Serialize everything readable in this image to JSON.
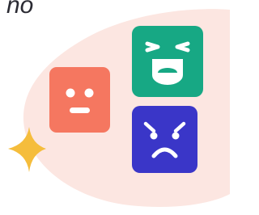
{
  "corner_text": "no",
  "colors": {
    "backdrop": "#fce6e1",
    "neutral_face": "#f57760",
    "shocked_face": "#17a884",
    "sad_face": "#3a36c8",
    "sparkle": "#f5bd3c",
    "face_features": "#ffffff"
  },
  "icons": {
    "neutral": "neutral-face-icon",
    "shocked": "shocked-face-icon",
    "sad": "sad-face-icon",
    "sparkle": "sparkle-icon"
  }
}
